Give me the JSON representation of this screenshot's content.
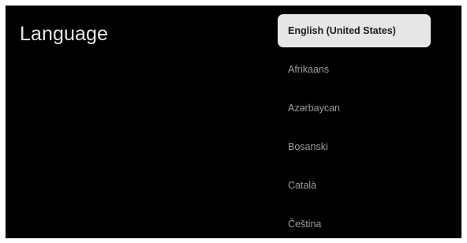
{
  "page": {
    "title": "Language"
  },
  "languages": {
    "items": [
      {
        "label": "English (United States)",
        "focused": true
      },
      {
        "label": "Afrikaans",
        "focused": false
      },
      {
        "label": "Azərbaycan",
        "focused": false
      },
      {
        "label": "Bosanski",
        "focused": false
      },
      {
        "label": "Català",
        "focused": false
      },
      {
        "label": "Čeština",
        "focused": false
      }
    ]
  },
  "colors": {
    "background": "#000000",
    "focused_item_background": "#e6e6e6",
    "focused_item_text": "#1c1c1c",
    "item_text": "#9c9c9c",
    "title_text": "#e8e8e8"
  }
}
